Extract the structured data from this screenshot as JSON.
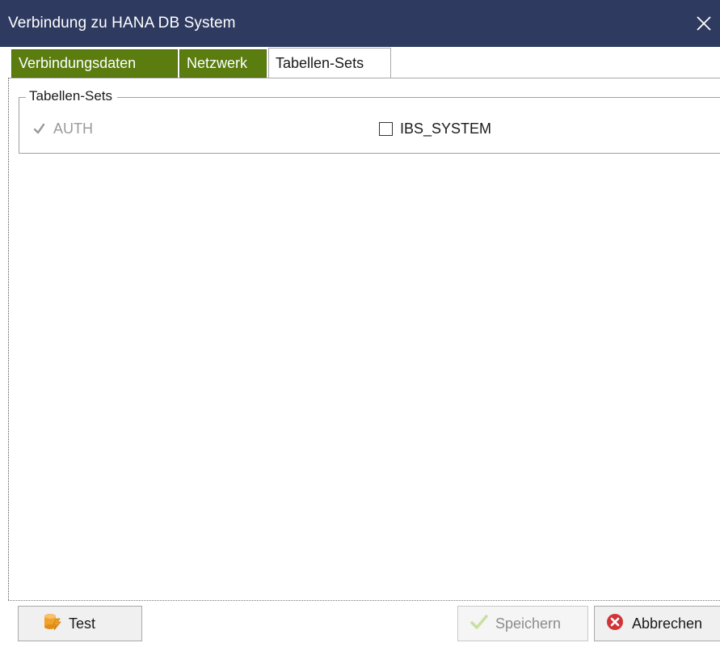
{
  "window": {
    "title": "Verbindung zu HANA DB System"
  },
  "tabs": [
    {
      "label": "Verbindungsdaten",
      "state": "green"
    },
    {
      "label": "Netzwerk",
      "state": "green"
    },
    {
      "label": "Tabellen-Sets",
      "state": "active"
    }
  ],
  "tableSets": {
    "group_title": "Tabellen-Sets",
    "items": [
      {
        "label": "AUTH",
        "checked": true,
        "disabled": true
      },
      {
        "label": "IBS_SYSTEM",
        "checked": false,
        "disabled": false
      }
    ]
  },
  "footer": {
    "test_label": "Test",
    "save_label": "Speichern",
    "cancel_label": "Abbrechen"
  },
  "colors": {
    "titlebar": "#2f3a60",
    "tab_green": "#5b7d10",
    "cancel_icon": "#d13438",
    "test_icon": "#f2a12a"
  }
}
